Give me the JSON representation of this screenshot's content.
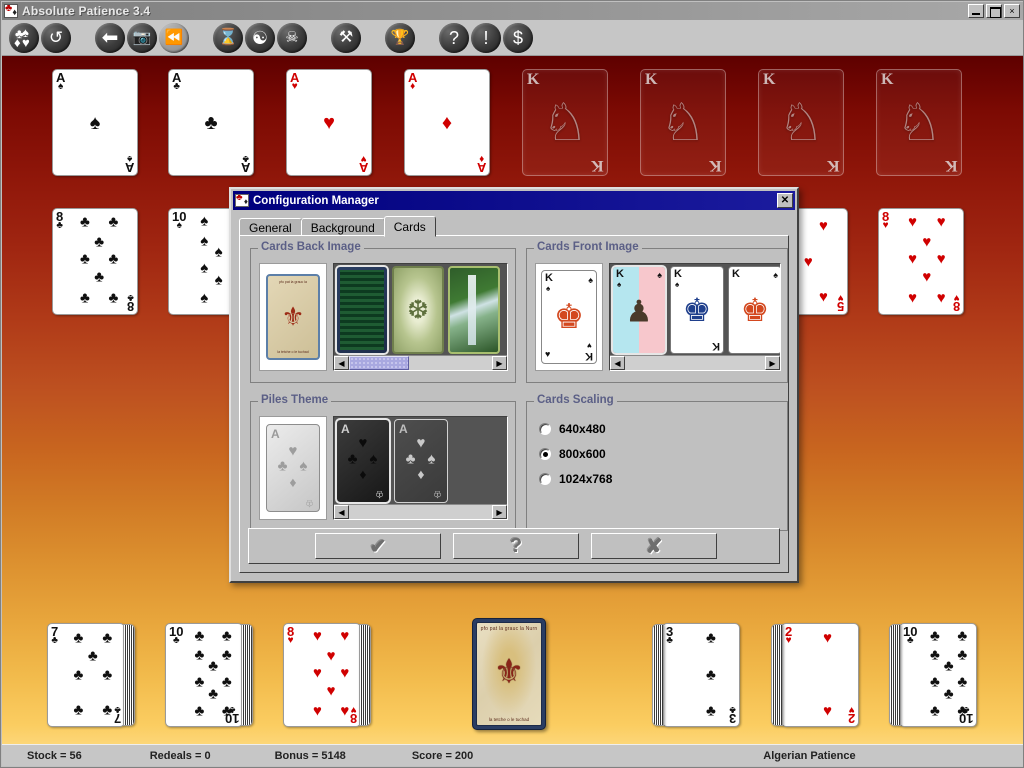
{
  "window": {
    "title": "Absolute Patience 3.4",
    "icon": "cards-icon",
    "minimize_label": "_",
    "maximize_label": "□",
    "close_label": "×"
  },
  "toolbar": {
    "buttons": [
      {
        "name": "new-game-button",
        "icon": "suits-icon",
        "glyph": "clubs-diamonds-hearts-spades",
        "enabled": true
      },
      {
        "name": "restart-button",
        "icon": "restart-icon",
        "glyph": "↺",
        "enabled": true
      },
      {
        "name": "undo-button",
        "icon": "undo-arrow-icon",
        "glyph": "⬅",
        "enabled": true
      },
      {
        "name": "snapshot-button",
        "icon": "camera-icon",
        "glyph": "📷",
        "enabled": true
      },
      {
        "name": "rewind-button",
        "icon": "rewind-icon",
        "glyph": "⏪",
        "enabled": false
      },
      {
        "name": "timer-button",
        "icon": "hourglass-icon",
        "glyph": "⧗",
        "enabled": true
      },
      {
        "name": "auto-play-button",
        "icon": "yin-yang-icon",
        "glyph": "☯",
        "enabled": true
      },
      {
        "name": "abandon-button",
        "icon": "skull-icon",
        "glyph": "☠",
        "enabled": true
      },
      {
        "name": "configuration-button",
        "icon": "tools-icon",
        "glyph": "⚒",
        "enabled": true
      },
      {
        "name": "high-scores-button",
        "icon": "trophy-icon",
        "glyph": "🏆",
        "enabled": true
      },
      {
        "name": "help-button",
        "icon": "question-icon",
        "glyph": "?",
        "enabled": true
      },
      {
        "name": "hint-button",
        "icon": "exclamation-icon",
        "glyph": "!",
        "enabled": true
      },
      {
        "name": "register-button",
        "icon": "dollar-icon",
        "glyph": "$",
        "enabled": true
      }
    ]
  },
  "board": {
    "foundations": [
      {
        "rank": "A",
        "suit": "♠",
        "color": "black",
        "placeholder": false
      },
      {
        "rank": "A",
        "suit": "♣",
        "color": "black",
        "placeholder": false
      },
      {
        "rank": "A",
        "suit": "♥",
        "color": "red",
        "placeholder": false
      },
      {
        "rank": "A",
        "suit": "♦",
        "color": "red",
        "placeholder": false
      },
      {
        "rank": "K",
        "suit": "",
        "color": "ghost",
        "placeholder": true
      },
      {
        "rank": "K",
        "suit": "",
        "color": "ghost",
        "placeholder": true
      },
      {
        "rank": "K",
        "suit": "",
        "color": "ghost",
        "placeholder": true
      },
      {
        "rank": "K",
        "suit": "",
        "color": "ghost",
        "placeholder": true
      }
    ],
    "tableau_top": [
      {
        "rank": "8",
        "suit": "♣",
        "color": "black"
      },
      {
        "rank": "10",
        "suit": "♠",
        "color": "black"
      },
      {
        "rank": "5",
        "suit": "♥",
        "color": "red"
      },
      {
        "rank": "8",
        "suit": "♥",
        "color": "red"
      }
    ],
    "tableau_bottom": [
      {
        "rank": "7",
        "suit": "♣",
        "color": "black",
        "stacked": true
      },
      {
        "rank": "10",
        "suit": "♣",
        "color": "black",
        "stacked": true
      },
      {
        "rank": "8",
        "suit": "♥",
        "color": "red",
        "stacked": true
      },
      {
        "rank": "3",
        "suit": "♣",
        "color": "black",
        "stacked": true
      },
      {
        "rank": "2",
        "suit": "♥",
        "color": "red",
        "stacked": true
      },
      {
        "rank": "10",
        "suit": "♣",
        "color": "black",
        "stacked": true
      }
    ],
    "stock_pile": {
      "name": "stock-pile-card-back",
      "top_text": "pfo pat la      grauc la Nurn",
      "crest": "⚜",
      "bottom_text": "la tetche       o le tuchad"
    }
  },
  "status_bar": {
    "stock": "Stock = 56",
    "redeals": "Redeals = 0",
    "bonus": "Bonus = 5148",
    "score": "Score = 200",
    "game_name": "Algerian Patience"
  },
  "dialog": {
    "title": "Configuration Manager",
    "close_label": "✕",
    "tabs": [
      {
        "label": "General",
        "active": false
      },
      {
        "label": "Background",
        "active": false
      },
      {
        "label": "Cards",
        "active": true
      }
    ],
    "groups": {
      "cards_back_image": {
        "legend": "Cards Back Image",
        "preview_name": "cards-back-preview",
        "items": [
          {
            "name": "back-thumb-heraldic",
            "selected": true,
            "style": "heraldic"
          },
          {
            "name": "back-thumb-green-floral",
            "selected": false,
            "style": "green-floral"
          },
          {
            "name": "back-thumb-green-ornate",
            "selected": false,
            "style": "green-ornate"
          },
          {
            "name": "back-thumb-waterfall",
            "selected": false,
            "style": "waterfall"
          }
        ],
        "scroll_left": "◀",
        "scroll_right": "▶"
      },
      "cards_front_image": {
        "legend": "Cards Front Image",
        "preview_name": "cards-front-preview",
        "items": [
          {
            "name": "front-thumb-persian",
            "selected": true,
            "rank": "K",
            "suit": "♠"
          },
          {
            "name": "front-thumb-classic",
            "selected": false,
            "rank": "K",
            "suit": "♠"
          },
          {
            "name": "front-thumb-antique",
            "selected": false,
            "rank": "K",
            "suit": "♠"
          }
        ],
        "scroll_left": "◀",
        "scroll_right": "▶"
      },
      "piles_theme": {
        "legend": "Piles Theme",
        "preview_name": "piles-theme-preview",
        "items": [
          {
            "name": "piles-thumb-dark",
            "selected": true,
            "label": "A"
          },
          {
            "name": "piles-thumb-light",
            "selected": false,
            "label": "A"
          }
        ],
        "scroll_left": "◀",
        "scroll_right": "▶"
      },
      "cards_scaling": {
        "legend": "Cards Scaling",
        "options": [
          {
            "label": "640x480",
            "selected": false
          },
          {
            "label": "800x600",
            "selected": true
          },
          {
            "label": "1024x768",
            "selected": false
          }
        ]
      }
    },
    "buttons": [
      {
        "name": "ok-button",
        "icon": "checkmark-icon",
        "glyph": "✔"
      },
      {
        "name": "help-button",
        "icon": "question-icon",
        "glyph": "?"
      },
      {
        "name": "cancel-button",
        "icon": "cross-icon",
        "glyph": "✘"
      }
    ]
  },
  "colors": {
    "felt_top": "#5e0000",
    "felt_bottom": "#fcd77a",
    "dialog_face": "#c0c0c0",
    "dialog_title": "#00007d",
    "legend_text": "#5b5f86",
    "scrollbar_thumb": "#a9a8e0"
  }
}
